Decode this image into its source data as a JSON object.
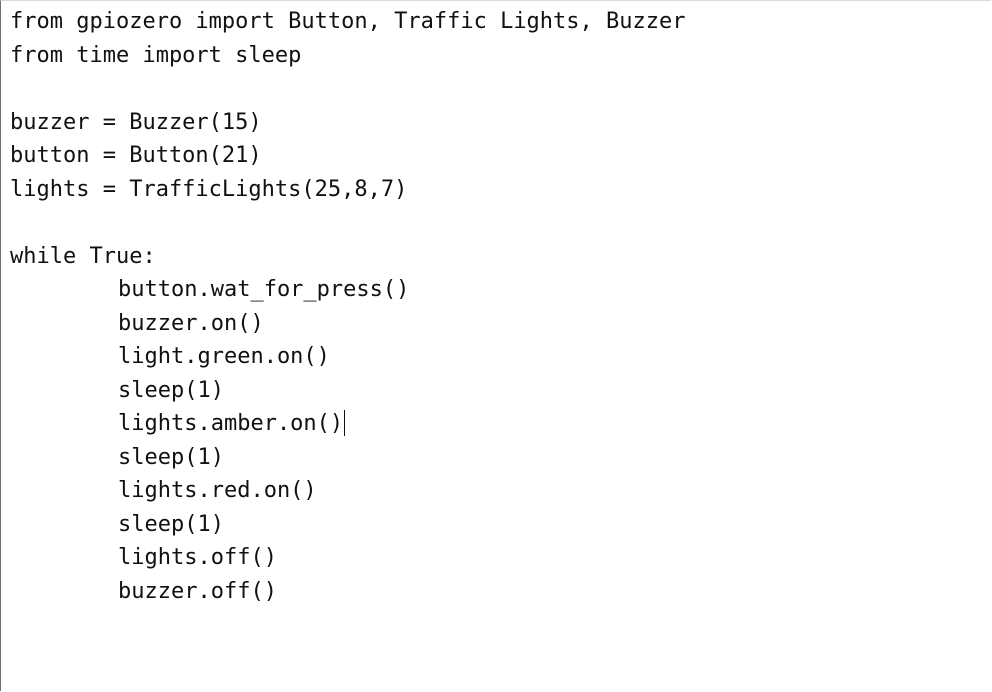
{
  "editor": {
    "lines": [
      {
        "text": "from gpiozero import Button, Traffic Lights, Buzzer",
        "indent": false
      },
      {
        "text": "from time import sleep",
        "indent": false
      },
      {
        "text": "",
        "indent": false
      },
      {
        "text": "buzzer = Buzzer(15)",
        "indent": false
      },
      {
        "text": "button = Button(21)",
        "indent": false
      },
      {
        "text": "lights = TrafficLights(25,8,7)",
        "indent": false
      },
      {
        "text": "",
        "indent": false
      },
      {
        "text": "while True:",
        "indent": false
      },
      {
        "text": "button.wat_for_press()",
        "indent": true
      },
      {
        "text": "buzzer.on()",
        "indent": true
      },
      {
        "text": "light.green.on()",
        "indent": true
      },
      {
        "text": "sleep(1)",
        "indent": true
      },
      {
        "text": "lights.amber.on()",
        "indent": true,
        "caret": true
      },
      {
        "text": "sleep(1)",
        "indent": true
      },
      {
        "text": "lights.red.on()",
        "indent": true
      },
      {
        "text": "sleep(1)",
        "indent": true
      },
      {
        "text": "lights.off()",
        "indent": true
      },
      {
        "text": "buzzer.off()",
        "indent": true
      }
    ]
  }
}
